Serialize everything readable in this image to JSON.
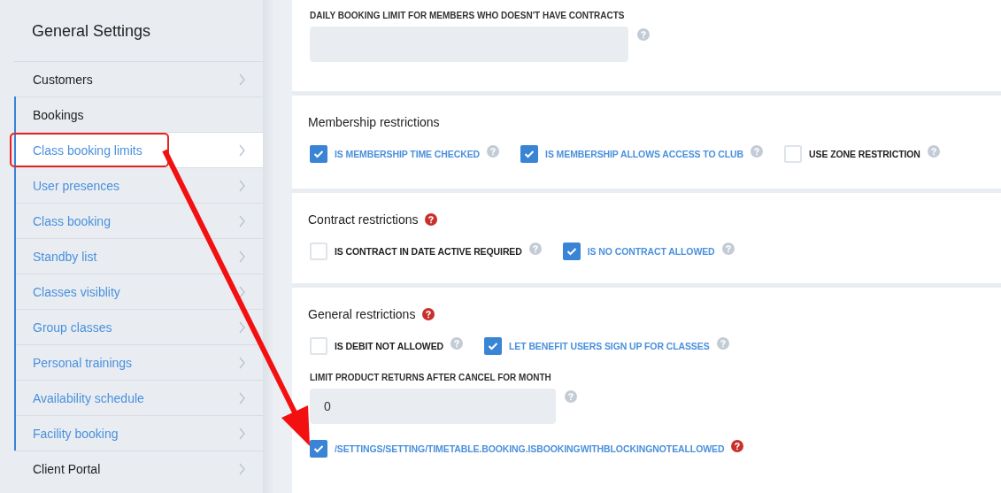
{
  "sidebar": {
    "title": "General Settings",
    "items": [
      {
        "label": "Customers",
        "expanded": false
      },
      {
        "label": "Bookings",
        "expanded": true,
        "children": [
          {
            "label": "Class booking limits",
            "selected": true,
            "highlighted": true
          },
          {
            "label": "User presences",
            "selected": false,
            "highlighted": false
          },
          {
            "label": "Class booking",
            "selected": false,
            "highlighted": false
          },
          {
            "label": "Standby list",
            "selected": false,
            "highlighted": false
          },
          {
            "label": "Classes visiblity",
            "selected": false,
            "highlighted": false
          },
          {
            "label": "Group classes",
            "selected": false,
            "highlighted": false
          },
          {
            "label": "Personal trainings",
            "selected": false,
            "highlighted": false
          },
          {
            "label": "Availability schedule",
            "selected": false,
            "highlighted": false
          },
          {
            "label": "Facility booking",
            "selected": false,
            "highlighted": false
          }
        ]
      },
      {
        "label": "Client Portal",
        "expanded": false
      }
    ]
  },
  "sections": [
    {
      "rows": [
        {
          "kind": "field",
          "label": "DAILY BOOKING LIMIT FOR MEMBERS WHO DOESN'T HAVE CONTRACTS",
          "help_alert": false
        }
      ]
    },
    {
      "title": "Membership restrictions",
      "rows": [
        {
          "kind": "options",
          "options": [
            {
              "label": "IS MEMBERSHIP TIME CHECKED",
              "checked": true,
              "help_alert": false
            },
            {
              "label": "IS MEMBERSHIP ALLOWS ACCESS TO CLUB",
              "checked": true,
              "help_alert": false
            },
            {
              "label": "USE ZONE RESTRICTION",
              "checked": false,
              "help_alert": false
            }
          ]
        }
      ]
    },
    {
      "title": "Contract restrictions",
      "title_help_alert": true,
      "rows": [
        {
          "kind": "options",
          "options": [
            {
              "label": "IS CONTRACT IN DATE ACTIVE REQUIRED",
              "checked": false,
              "help_alert": false
            },
            {
              "label": "IS NO CONTRACT ALLOWED",
              "checked": true,
              "help_alert": false
            }
          ]
        }
      ]
    },
    {
      "title": "General restrictions",
      "title_help_alert": true,
      "rows": [
        {
          "kind": "options",
          "options": [
            {
              "label": "IS DEBIT NOT ALLOWED",
              "checked": false,
              "help_alert": false
            },
            {
              "label": "LET BENEFIT USERS SIGN UP FOR CLASSES",
              "checked": true,
              "help_alert": false
            }
          ]
        },
        {
          "kind": "field",
          "label": "LIMIT PRODUCT RETURNS AFTER CANCEL FOR MONTH",
          "value": "0",
          "help_alert": false
        },
        {
          "kind": "options",
          "options": [
            {
              "label": "/SETTINGS/SETTING/TIMETABLE.BOOKING.ISBOOKINGWITHBLOCKINGNOTEALLOWED",
              "checked": true,
              "help_alert": true
            }
          ]
        }
      ]
    }
  ]
}
